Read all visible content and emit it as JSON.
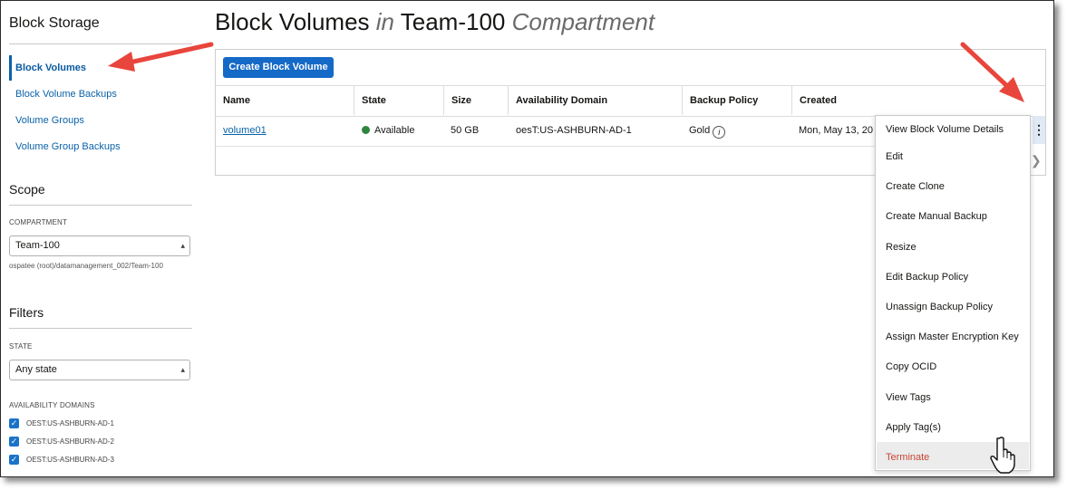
{
  "sidebar": {
    "title": "Block Storage",
    "items": [
      {
        "label": "Block Volumes",
        "active": true
      },
      {
        "label": "Block Volume Backups",
        "active": false
      },
      {
        "label": "Volume Groups",
        "active": false
      },
      {
        "label": "Volume Group Backups",
        "active": false
      }
    ],
    "scope": {
      "title": "Scope",
      "compartment_caption": "COMPARTMENT",
      "compartment_value": "Team-100",
      "compartment_path": "ospatee (root)/datamanagement_002/Team-100"
    },
    "filters": {
      "title": "Filters",
      "state_caption": "STATE",
      "state_value": "Any state",
      "ad_caption": "AVAILABILITY DOMAINS",
      "domains": [
        "OEST:US-ASHBURN-AD-1",
        "OEST:US-ASHBURN-AD-2",
        "OEST:US-ASHBURN-AD-3"
      ]
    }
  },
  "header": {
    "title_part1": "Block Volumes ",
    "title_in": "in",
    "title_part2": " Team-100 ",
    "title_compartment": "Compartment"
  },
  "toolbar": {
    "create_label": "Create Block Volume"
  },
  "table": {
    "columns": [
      "Name",
      "State",
      "Size",
      "Availability Domain",
      "Backup Policy",
      "Created"
    ],
    "rows": [
      {
        "name": "volume01",
        "state": "Available",
        "size": "50 GB",
        "availability_domain": "oesT:US-ASHBURN-AD-1",
        "backup_policy": "Gold",
        "created": "Mon, May 13, 20"
      }
    ]
  },
  "row_menu": {
    "items": [
      "View Block Volume Details",
      "Edit",
      "Create Clone",
      "Create Manual Backup",
      "Resize",
      "Edit Backup Policy",
      "Unassign Backup Policy",
      "Assign Master Encryption Key",
      "Copy OCID",
      "View Tags",
      "Apply Tag(s)",
      "Terminate"
    ]
  },
  "icons": {
    "kebab": "vertical-ellipsis-icon",
    "info": "info-icon",
    "select_chevron": "chevron-updown-icon",
    "pager": "chevron-right-icon",
    "cursor": "hand-pointer-icon",
    "status": "status-dot-icon"
  },
  "colors": {
    "accent": "#1569c7",
    "link": "#0a62a8",
    "status_available": "#2e8540",
    "danger": "#c74634",
    "annotation_arrow": "#e8453c"
  }
}
